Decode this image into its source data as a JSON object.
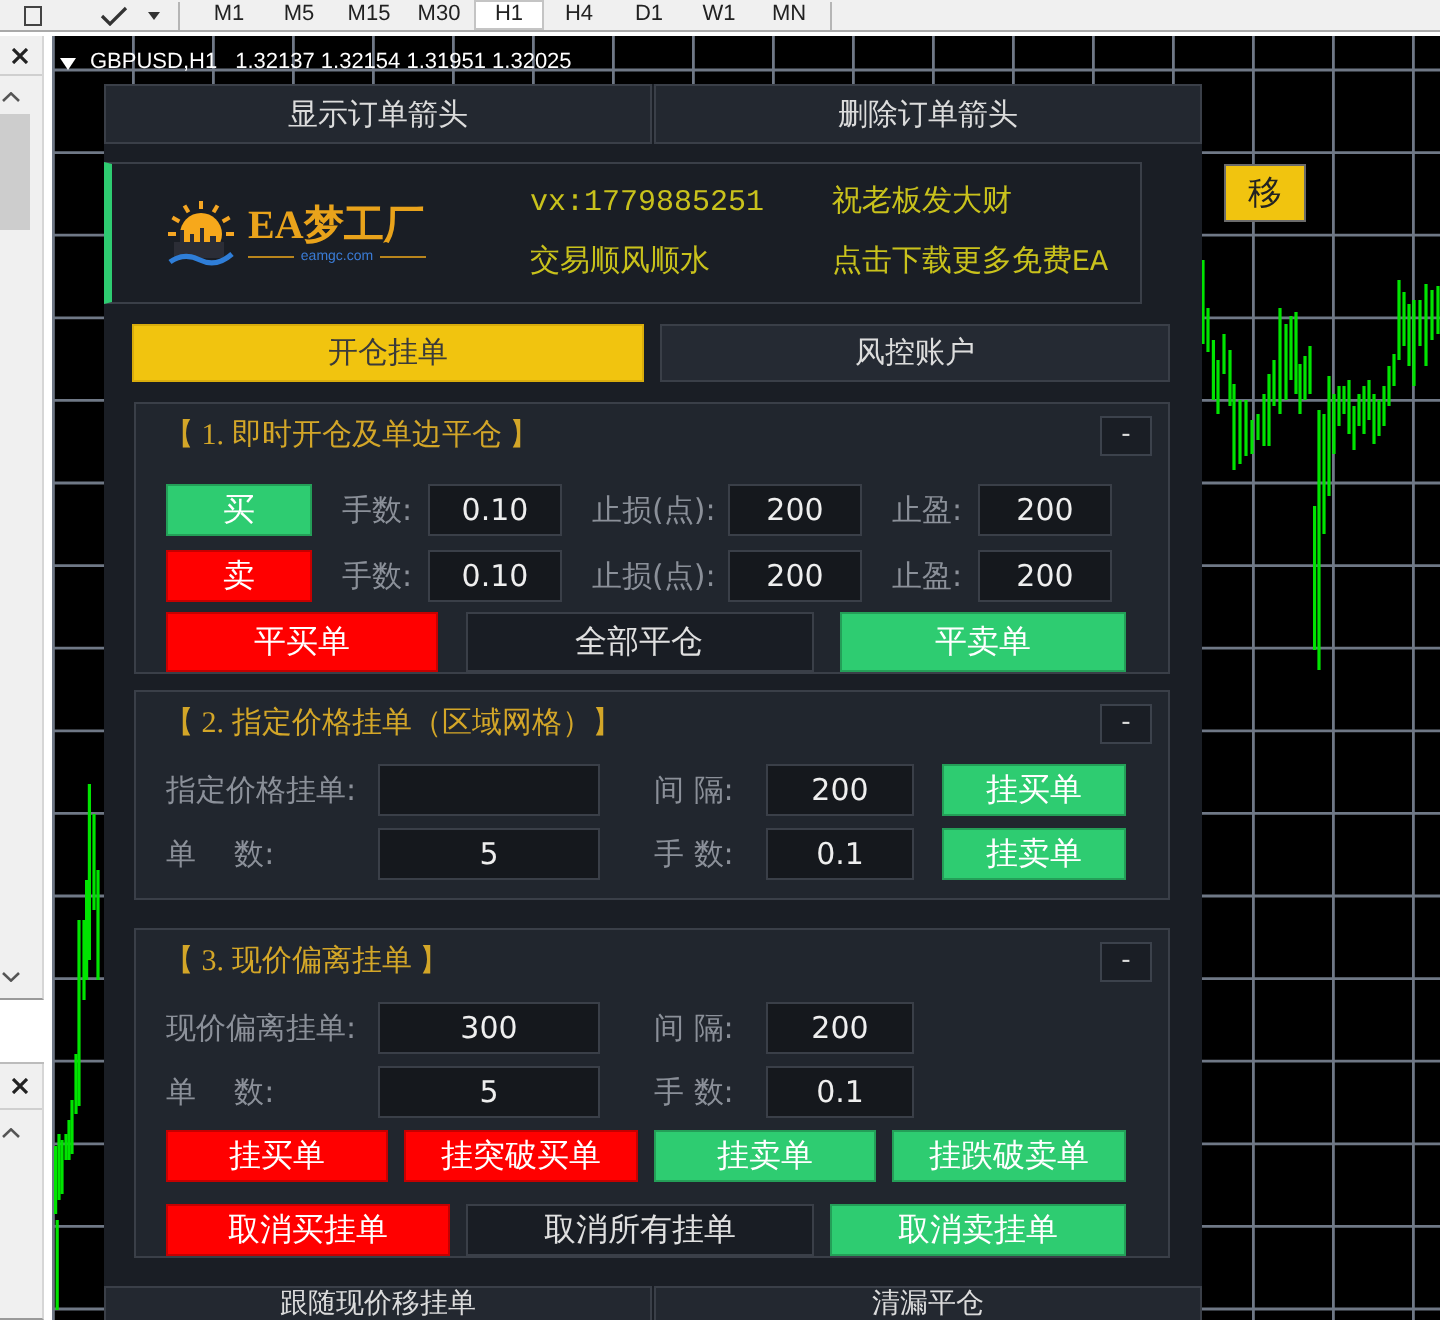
{
  "toolbar": {
    "timeframes": [
      {
        "label": "M1",
        "selected": false
      },
      {
        "label": "M5",
        "selected": false
      },
      {
        "label": "M15",
        "selected": false
      },
      {
        "label": "M30",
        "selected": false
      },
      {
        "label": "H1",
        "selected": true
      },
      {
        "label": "H4",
        "selected": false
      },
      {
        "label": "D1",
        "selected": false
      },
      {
        "label": "W1",
        "selected": false
      },
      {
        "label": "MN",
        "selected": false
      }
    ]
  },
  "chart": {
    "title": "GBPUSD,H1",
    "quotes": "1.32137 1.32154 1.31951 1.32025",
    "move_button": "移"
  },
  "panel": {
    "top_buttons": [
      {
        "label": "显示订单箭头"
      },
      {
        "label": "删除订单箭头"
      }
    ],
    "banner": {
      "logo_name": "EA梦工厂",
      "logo_site": "eamgc.com",
      "lines": [
        "vx:1779885251",
        "祝老板发大财",
        "交易顺风顺水",
        "点击下载更多免费EA"
      ]
    },
    "tabs": [
      {
        "label": "开仓挂单",
        "selected": true
      },
      {
        "label": "风控账户",
        "selected": false
      }
    ],
    "sections": [
      {
        "title": "【 1. 即时开仓及单边平仓 】",
        "collapse": "-",
        "rows": [
          {
            "kind": "order",
            "button": {
              "label": "买",
              "color": "#2ecc71"
            },
            "fields": [
              {
                "label": "手数:",
                "value": "0.10"
              },
              {
                "label": "止损(点):",
                "value": "200"
              },
              {
                "label": "止盈:",
                "value": "200"
              }
            ]
          },
          {
            "kind": "order",
            "button": {
              "label": "卖",
              "color": "#ff0000"
            },
            "fields": [
              {
                "label": "手数:",
                "value": "0.10"
              },
              {
                "label": "止损(点):",
                "value": "200"
              },
              {
                "label": "止盈:",
                "value": "200"
              }
            ]
          },
          {
            "kind": "buttons",
            "buttons": [
              {
                "label": "平买单",
                "color": "#ff0000"
              },
              {
                "label": "全部平仓",
                "color": "#191d24"
              },
              {
                "label": "平卖单",
                "color": "#2ecc71"
              }
            ]
          }
        ]
      },
      {
        "title": "【 2. 指定价格挂单（区域网格）】",
        "collapse": "-",
        "rows": [
          {
            "kind": "fields",
            "fields": [
              {
                "label": "指定价格挂单:"
              },
              {
                "label": "间 隔:",
                "value": "200"
              }
            ],
            "button": {
              "label": "挂买单",
              "color": "#2ecc71"
            }
          },
          {
            "kind": "fields",
            "fields": [
              {
                "label": "单    数:",
                "value": "5"
              },
              {
                "label": "手 数:",
                "value": "0.1"
              }
            ],
            "button": {
              "label": "挂卖单",
              "color": "#2ecc71"
            }
          }
        ]
      },
      {
        "title": "【 3. 现价偏离挂单 】",
        "collapse": "-",
        "rows": [
          {
            "kind": "fields",
            "fields": [
              {
                "label": "现价偏离挂单:",
                "value": "300"
              },
              {
                "label": "间 隔:",
                "value": "200"
              }
            ]
          },
          {
            "kind": "fields",
            "fields": [
              {
                "label": "单    数:",
                "value": "5"
              },
              {
                "label": "手 数:",
                "value": "0.1"
              }
            ]
          },
          {
            "kind": "buttons",
            "buttons": [
              {
                "label": "挂买单",
                "color": "#ff0000"
              },
              {
                "label": "挂突破买单",
                "color": "#ff0000"
              },
              {
                "label": "挂卖单",
                "color": "#2ecc71"
              },
              {
                "label": "挂跌破卖单",
                "color": "#2ecc71"
              }
            ]
          },
          {
            "kind": "buttons",
            "buttons": [
              {
                "label": "取消买挂单",
                "color": "#ff0000"
              },
              {
                "label": "取消所有挂单",
                "color": "#191d24"
              },
              {
                "label": "取消卖挂单",
                "color": "#2ecc71"
              }
            ]
          }
        ]
      }
    ],
    "bottom_buttons": [
      {
        "label": "跟随现价移挂单"
      },
      {
        "label": "清漏平仓"
      }
    ]
  }
}
